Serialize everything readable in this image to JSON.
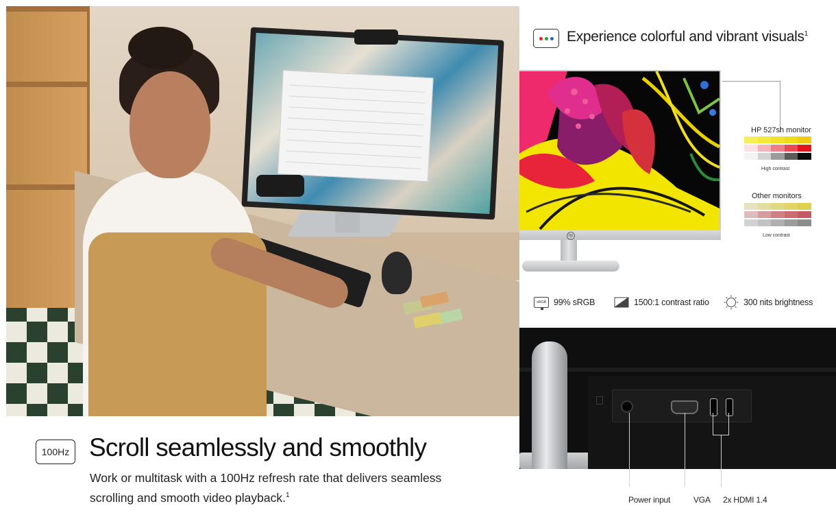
{
  "lifestyle_photo": {
    "alt": "Woman typing at desk with HP monitor"
  },
  "refresh_section": {
    "badge": "100Hz",
    "title": "Scroll seamlessly and smoothly",
    "description": "Work or multitask with a 100Hz refresh rate that delivers seamless scrolling and smooth video playback.",
    "footnote": "1"
  },
  "color_section": {
    "title": "Experience colorful and vibrant visuals",
    "footnote": "1",
    "icon": "rgb-dots-icon",
    "dot_colors": [
      "#e4252b",
      "#2a9d3a",
      "#2b5fc9"
    ],
    "comparison": {
      "hp": {
        "title": "HP 527sh monitor",
        "caption": "High contrast",
        "swatch_rows": [
          [
            "#f7ef5a",
            "#f5e93b",
            "#f2e128",
            "#f0db18",
            "#f1cd12"
          ],
          [
            "#fbe1e3",
            "#f4b4b9",
            "#ec7f88",
            "#e94b55",
            "#e2151f"
          ],
          [
            "#f3f3f3",
            "#d3d3d3",
            "#9c9c9c",
            "#5b5b5b",
            "#0d0d0d"
          ]
        ]
      },
      "other": {
        "title": "Other monitors",
        "caption": "Low contrast",
        "swatch_rows": [
          [
            "#e6e3c0",
            "#e3dea0",
            "#e1d981",
            "#e0d566",
            "#dfd04f"
          ],
          [
            "#dcbcbd",
            "#d59b9e",
            "#cf8085",
            "#cb6c72",
            "#c65a62"
          ],
          [
            "#d2d2d2",
            "#c2c2c2",
            "#afafaf",
            "#9c9c9c",
            "#8c8c8c"
          ]
        ]
      }
    },
    "specs": [
      {
        "icon": "srgb-icon",
        "icon_text": "sRGB",
        "label": "99% sRGB"
      },
      {
        "icon": "contrast-icon",
        "label": "1500:1 contrast ratio"
      },
      {
        "icon": "brightness-icon",
        "label": "300 nits brightness"
      }
    ]
  },
  "ports_section": {
    "labels": {
      "power": "Power input",
      "vga": "VGA",
      "hdmi": "2x HDMI 1.4"
    }
  }
}
